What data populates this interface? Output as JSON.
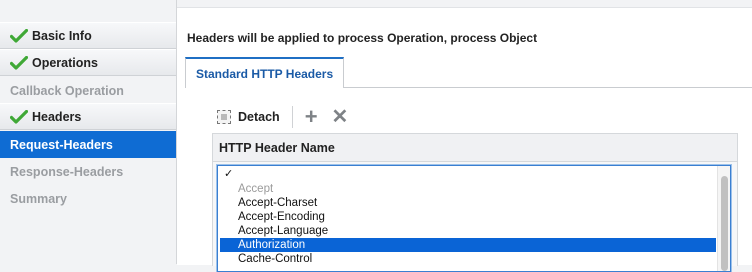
{
  "sidebar": {
    "items": [
      {
        "label": "Basic Info",
        "state": "done"
      },
      {
        "label": "Operations",
        "state": "done"
      },
      {
        "label": "Callback Operation",
        "state": "muted"
      },
      {
        "label": "Headers",
        "state": "done"
      },
      {
        "label": "Request-Headers",
        "state": "active"
      },
      {
        "label": "Response-Headers",
        "state": "muted"
      },
      {
        "label": "Summary",
        "state": "muted"
      }
    ]
  },
  "main": {
    "title": "Headers will be applied to process Operation, process Object",
    "tab_label": "Standard HTTP Headers"
  },
  "toolbar": {
    "detach_label": "Detach",
    "add_icon": "plus-icon",
    "delete_icon": "x-icon"
  },
  "table": {
    "column_header": "HTTP Header Name"
  },
  "dropdown": {
    "checkmark": "✓",
    "options": [
      {
        "label": "Accept",
        "state": "disabled"
      },
      {
        "label": "Accept-Charset",
        "state": "normal"
      },
      {
        "label": "Accept-Encoding",
        "state": "normal"
      },
      {
        "label": "Accept-Language",
        "state": "normal"
      },
      {
        "label": "Authorization",
        "state": "selected"
      },
      {
        "label": "Cache-Control",
        "state": "normal"
      }
    ]
  },
  "colors": {
    "accent": "#0f6cd3",
    "check_green": "#3fa836"
  }
}
